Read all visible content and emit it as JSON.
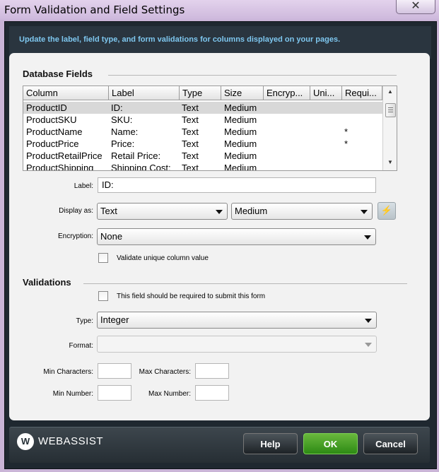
{
  "window": {
    "title": "Form Validation and Field Settings",
    "close_glyph": "✕"
  },
  "description": "Update the label, field type, and form validations for columns displayed on your pages.",
  "database_fields": {
    "heading": "Database Fields",
    "columns": [
      "Column",
      "Label",
      "Type",
      "Size",
      "Encryp...",
      "Uni...",
      "Requi..."
    ],
    "rows": [
      [
        "ProductID",
        "ID:",
        "Text",
        "Medium",
        "",
        "",
        ""
      ],
      [
        "ProductSKU",
        "SKU:",
        "Text",
        "Medium",
        "",
        "",
        ""
      ],
      [
        "ProductName",
        "Name:",
        "Text",
        "Medium",
        "",
        "",
        "*"
      ],
      [
        "ProductPrice",
        "Price:",
        "Text",
        "Medium",
        "",
        "",
        "*"
      ],
      [
        "ProductRetailPrice",
        "Retail Price:",
        "Text",
        "Medium",
        "",
        "",
        ""
      ],
      [
        "ProductShipping",
        "Shipping Cost:",
        "Text",
        "Medium",
        "",
        "",
        ""
      ]
    ],
    "selected_row": 0
  },
  "field": {
    "label_caption": "Label:",
    "label_value": "ID:",
    "display_caption": "Display as:",
    "display_type": "Text",
    "display_size": "Medium",
    "encryption_caption": "Encryption:",
    "encryption_value": "None",
    "unique_label": "Validate unique column value",
    "unique_checked": false
  },
  "validations": {
    "heading": "Validations",
    "required_label": "This field should be required to submit this form",
    "required_checked": false,
    "type_caption": "Type:",
    "type_value": "Integer",
    "format_caption": "Format:",
    "format_value": "",
    "min_chars_caption": "Min Characters:",
    "max_chars_caption": "Max Characters:",
    "min_number_caption": "Min Number:",
    "max_number_caption": "Max Number:",
    "min_chars": "",
    "max_chars": "",
    "min_number": "",
    "max_number": ""
  },
  "footer": {
    "logo_glyph": "W",
    "logo_text": "WEBASSIST",
    "help_label": "Help",
    "ok_label": "OK",
    "cancel_label": "Cancel"
  },
  "icons": {
    "close": "close-icon",
    "bolt": "lightning-icon",
    "logo": "webassist-logo-icon"
  },
  "colors": {
    "title_bar": "#cdb8dc",
    "frame": "#1f2830",
    "description_text": "#7ec7ef",
    "ok_button": "#3a9a1e"
  }
}
